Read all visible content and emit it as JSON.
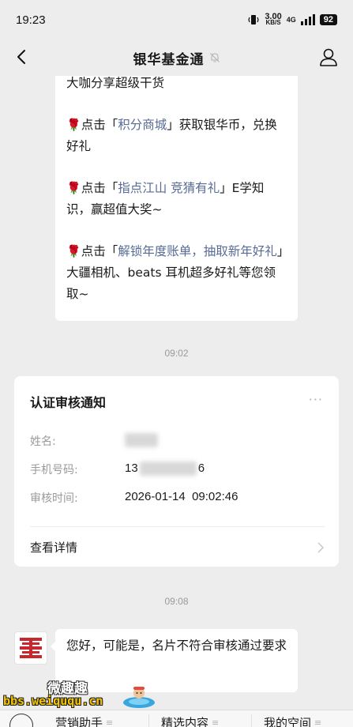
{
  "status_bar": {
    "time": "19:23",
    "speed_value": "3.00",
    "speed_unit": "KB/S",
    "network": "4G",
    "battery": "92"
  },
  "header": {
    "title": "银华基金通"
  },
  "messages": {
    "top_bubble": {
      "line1": "大咖分享超级干货",
      "p1_prefix": "点击「",
      "p1_link": "积分商城",
      "p1_suffix": "」获取银华币，兑换好礼",
      "p2_prefix": "点击「",
      "p2_link": "指点江山 竞猜有礼",
      "p2_suffix": "」E学知识，赢超值大奖~",
      "p3_prefix": "点击「",
      "p3_link": "解锁年度账单，抽取新年好礼",
      "p3_suffix": "」大疆相机、beats 耳机超多好礼等您领取~"
    },
    "time_1": "09:02",
    "card": {
      "title": "认证审核通知",
      "more": "···",
      "name_label": "姓名:",
      "phone_label": "手机号码:",
      "phone_prefix": "13",
      "phone_suffix": "6",
      "review_time_label": "审核时间:",
      "review_time_value": "2026-01-14  09:02:46",
      "detail_link": "查看详情"
    },
    "time_2": "09:08",
    "reply_bubble": {
      "text": "您好，可能是，名片不符合审核通过要求"
    }
  },
  "bottom_menu": {
    "items": [
      {
        "label": "营销助手"
      },
      {
        "label": "精选内容"
      },
      {
        "label": "我的空间"
      }
    ]
  },
  "watermark": {
    "cn": "微趣趣",
    "url": "bbs.weiququ.cn"
  },
  "colors": {
    "background": "#ededed",
    "link": "#576b95",
    "bubble": "#ffffff",
    "timestamp": "#9a9a9a",
    "avatar_red": "#c8282d"
  }
}
